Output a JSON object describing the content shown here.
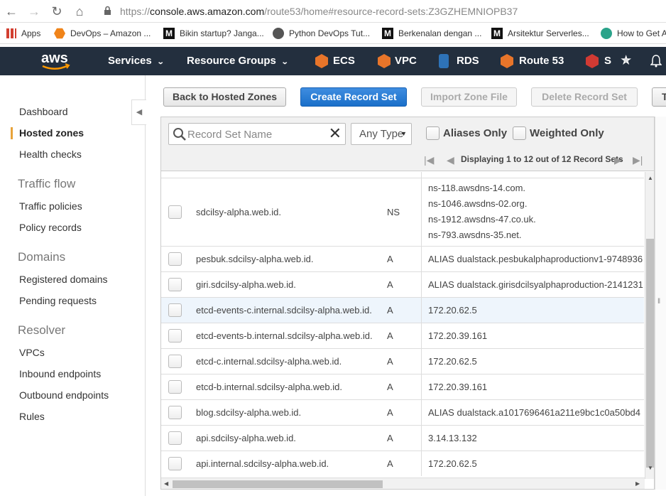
{
  "browser": {
    "url_prefix": "https://",
    "url_domain": "console.aws.amazon.com",
    "url_rest": "/route53/home#resource-record-sets:Z3GZHEMNIOPB37",
    "bookmarks": [
      {
        "label": "Apps",
        "icon": "apps-grid-icon",
        "color": "#d23f31"
      },
      {
        "label": "DevOps – Amazon ...",
        "icon": "hexagon-icon",
        "color": "#f0841a"
      },
      {
        "label": "Bikin startup? Janga...",
        "icon": "medium-icon",
        "color": "#111111"
      },
      {
        "label": "Python DevOps Tut...",
        "icon": "globe-icon",
        "color": "#555555"
      },
      {
        "label": "Berkenalan dengan ...",
        "icon": "medium-icon",
        "color": "#111111"
      },
      {
        "label": "Arsitektur Serverles...",
        "icon": "medium-icon",
        "color": "#111111"
      },
      {
        "label": "How to Get A",
        "icon": "circle-icon",
        "color": "#2aa38a"
      }
    ]
  },
  "header": {
    "logo": "aws",
    "services": "Services",
    "resource_groups": "Resource Groups",
    "shortcuts": [
      {
        "label": "ECS",
        "icon": "ecs-icon",
        "color": "#e8752a"
      },
      {
        "label": "VPC",
        "icon": "vpc-icon",
        "color": "#e8752a"
      },
      {
        "label": "RDS",
        "icon": "rds-icon",
        "color": "#2e73b8"
      },
      {
        "label": "Route 53",
        "icon": "route53-icon",
        "color": "#e8752a"
      },
      {
        "label": "S",
        "icon": "s-icon",
        "color": "#d13a33"
      }
    ]
  },
  "sidebar": {
    "items": [
      {
        "label": "Dashboard"
      },
      {
        "label": "Hosted zones",
        "active": true
      },
      {
        "label": "Health checks"
      }
    ],
    "traffic_flow": {
      "heading": "Traffic flow",
      "items": [
        "Traffic policies",
        "Policy records"
      ]
    },
    "domains": {
      "heading": "Domains",
      "items": [
        "Registered domains",
        "Pending requests"
      ]
    },
    "resolver": {
      "heading": "Resolver",
      "items": [
        "VPCs",
        "Inbound endpoints",
        "Outbound endpoints",
        "Rules"
      ]
    }
  },
  "toolbar": {
    "back": "Back to Hosted Zones",
    "create": "Create Record Set",
    "import": "Import Zone File",
    "delete": "Delete Record Set",
    "more": "T"
  },
  "filter": {
    "search_placeholder": "Record Set Name",
    "type": "Any Type",
    "aliases_only": "Aliases Only",
    "weighted_only": "Weighted Only",
    "pager": "Displaying 1 to 12 out of 12 Record Sets"
  },
  "records": [
    {
      "name": "sdcilsy-alpha.web.id.",
      "type": "NS",
      "values": [
        "ns-118.awsdns-14.com.",
        "ns-1046.awsdns-02.org.",
        "ns-1912.awsdns-47.co.uk.",
        "ns-793.awsdns-35.net."
      ]
    },
    {
      "name": "pesbuk.sdcilsy-alpha.web.id.",
      "type": "A",
      "values": [
        "ALIAS dualstack.pesbukalphaproductionv1-9748936"
      ]
    },
    {
      "name": "giri.sdcilsy-alpha.web.id.",
      "type": "A",
      "values": [
        "ALIAS dualstack.girisdcilsyalphaproduction-2141231"
      ]
    },
    {
      "name": "etcd-events-c.internal.sdcilsy-alpha.web.id.",
      "type": "A",
      "values": [
        "172.20.62.5"
      ],
      "highlight": true
    },
    {
      "name": "etcd-events-b.internal.sdcilsy-alpha.web.id.",
      "type": "A",
      "values": [
        "172.20.39.161"
      ]
    },
    {
      "name": "etcd-c.internal.sdcilsy-alpha.web.id.",
      "type": "A",
      "values": [
        "172.20.62.5"
      ]
    },
    {
      "name": "etcd-b.internal.sdcilsy-alpha.web.id.",
      "type": "A",
      "values": [
        "172.20.39.161"
      ]
    },
    {
      "name": "blog.sdcilsy-alpha.web.id.",
      "type": "A",
      "values": [
        "ALIAS dualstack.a1017696461a211e9bc1c0a50bd4"
      ]
    },
    {
      "name": "api.sdcilsy-alpha.web.id.",
      "type": "A",
      "values": [
        "3.14.13.132"
      ]
    },
    {
      "name": "api.internal.sdcilsy-alpha.web.id.",
      "type": "A",
      "values": [
        "172.20.62.5"
      ]
    }
  ]
}
